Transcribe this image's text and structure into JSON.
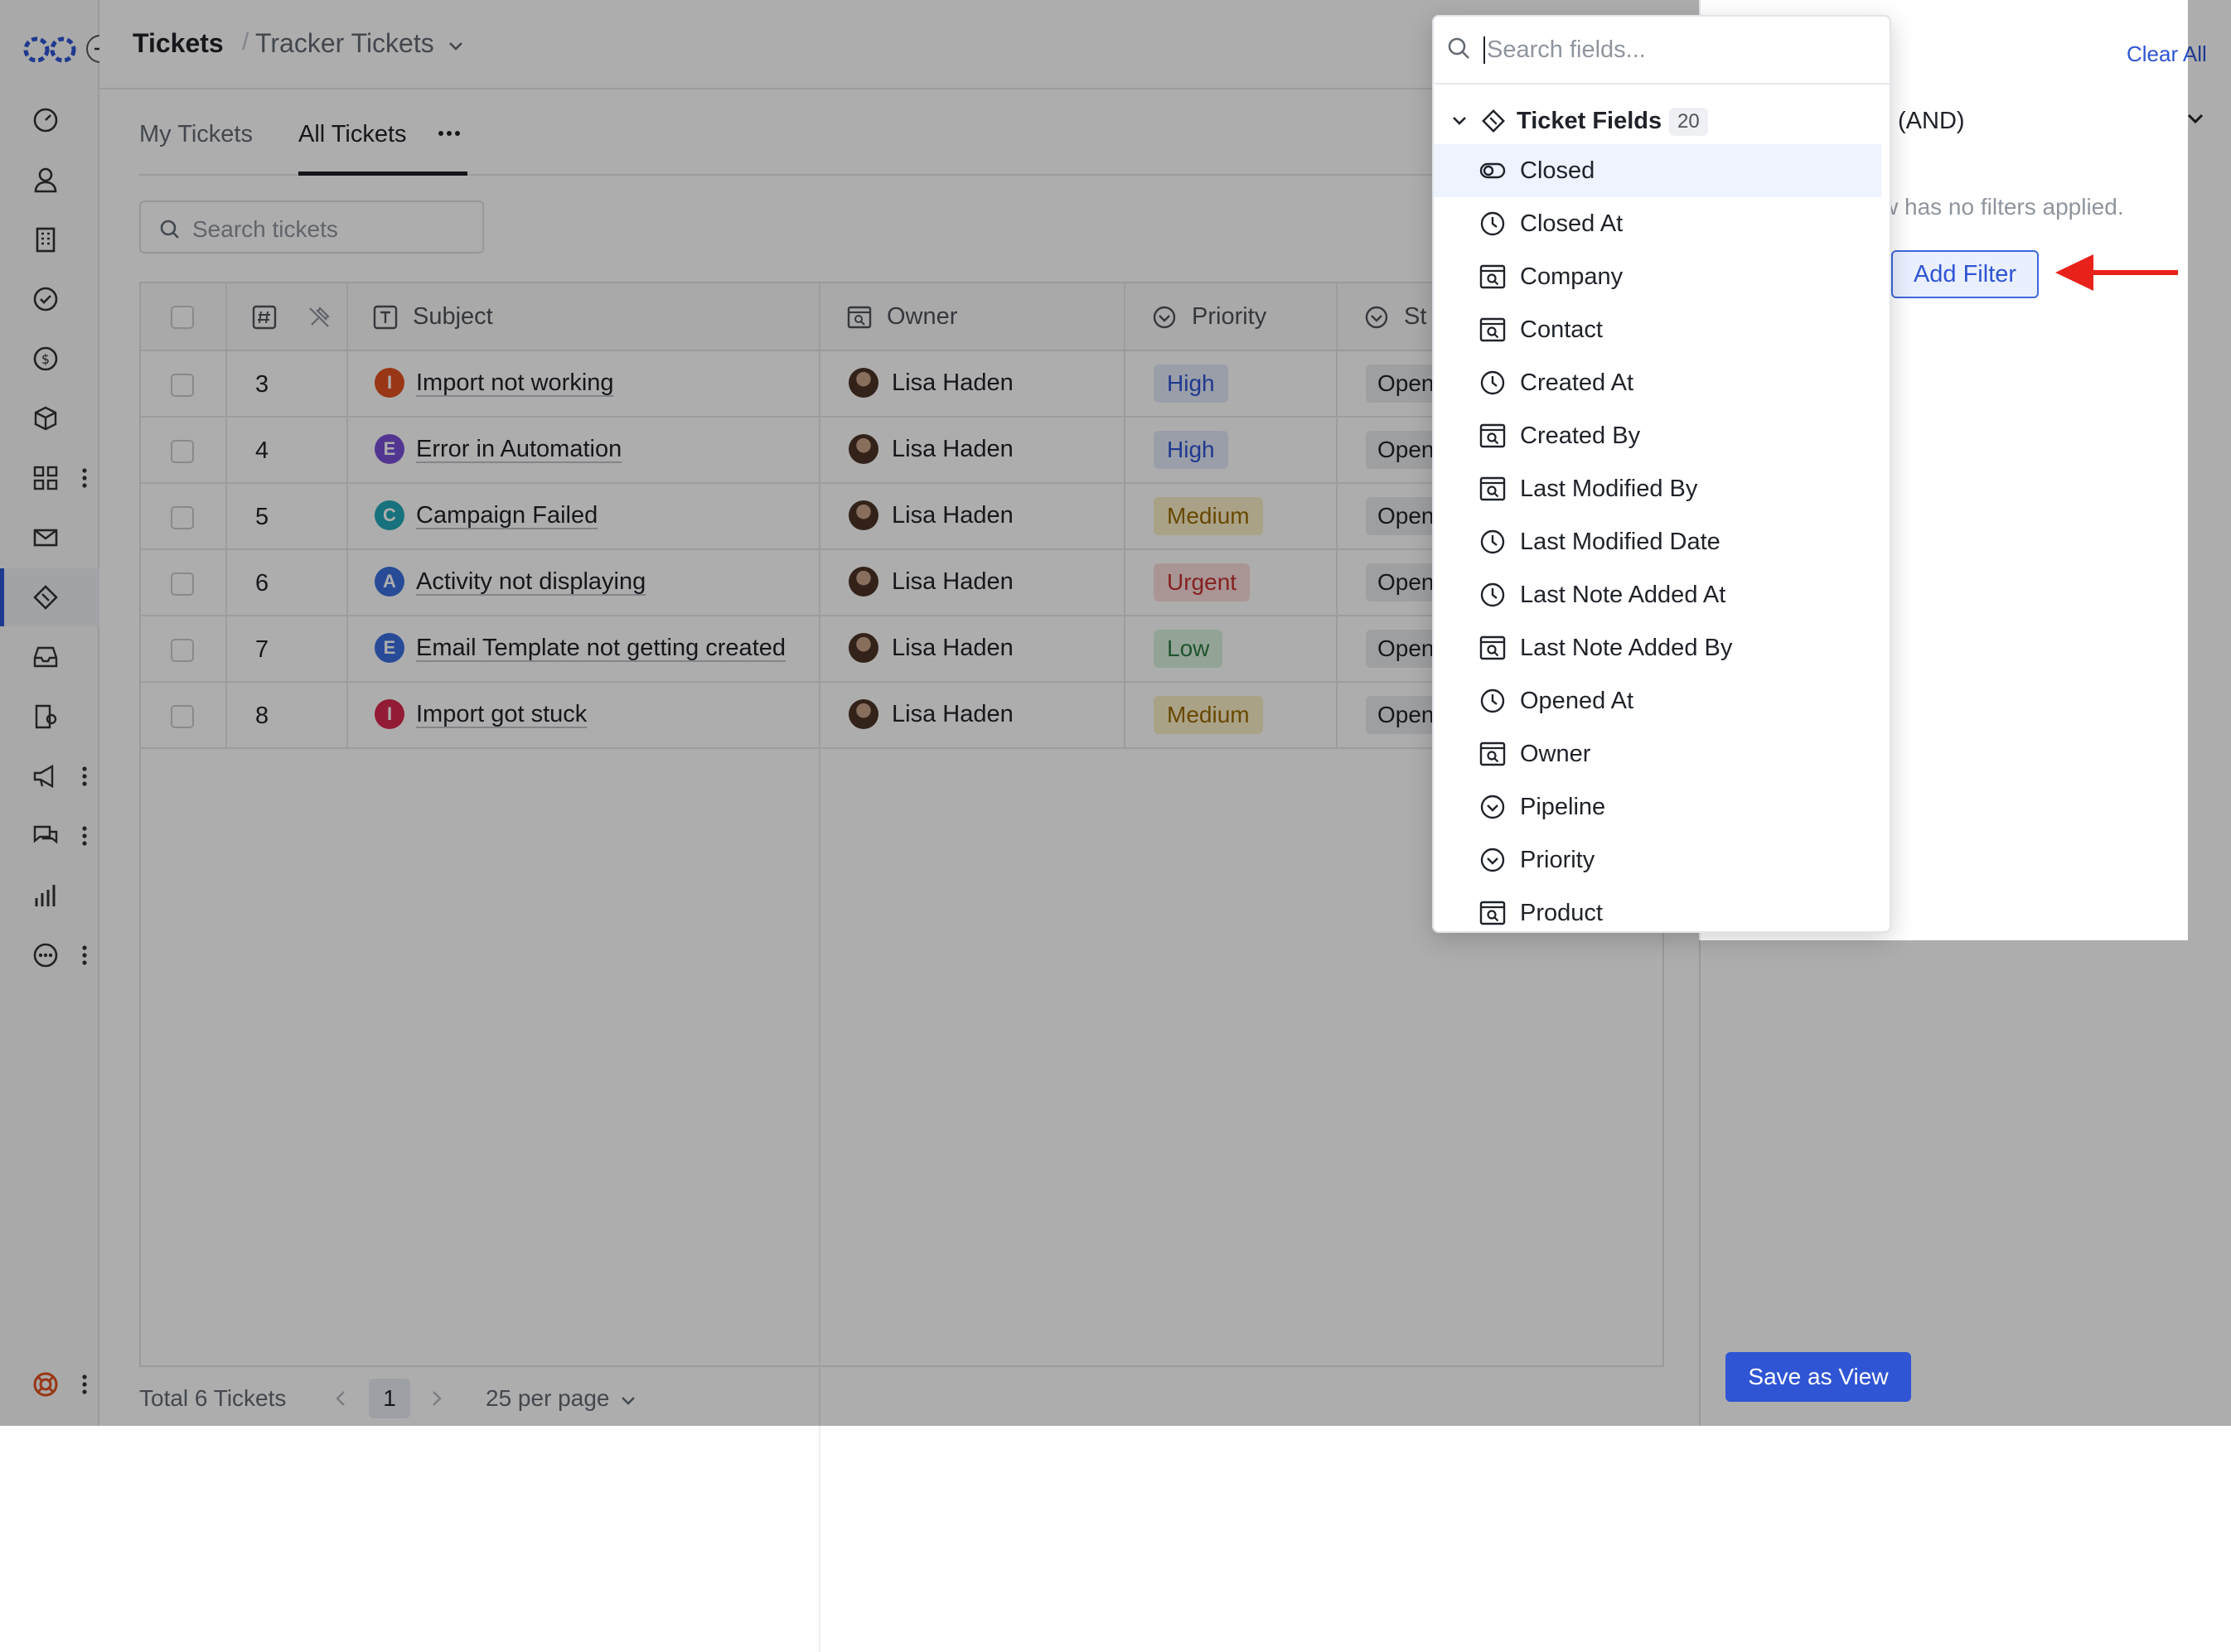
{
  "header": {
    "title": "Tickets",
    "separator": "/",
    "view_name": "Tracker Tickets"
  },
  "tabs": [
    {
      "label": "My Tickets"
    },
    {
      "label": "All Tickets"
    }
  ],
  "search": {
    "placeholder": "Search tickets"
  },
  "table": {
    "columns": {
      "id": "#",
      "subject": "Subject",
      "owner": "Owner",
      "priority": "Priority",
      "status": "St"
    },
    "rows": [
      {
        "id": "3",
        "subject": "Import not working",
        "badge": "I",
        "badge_color": "#e2501f",
        "owner": "Lisa Haden",
        "priority": "High",
        "status": "Open"
      },
      {
        "id": "4",
        "subject": "Error in Automation",
        "badge": "E",
        "badge_color": "#7a4fd6",
        "owner": "Lisa Haden",
        "priority": "High",
        "status": "Open"
      },
      {
        "id": "5",
        "subject": "Campaign Failed",
        "badge": "C",
        "badge_color": "#23a8b8",
        "owner": "Lisa Haden",
        "priority": "Medium",
        "status": "Open"
      },
      {
        "id": "6",
        "subject": "Activity not displaying",
        "badge": "A",
        "badge_color": "#3b6fe0",
        "owner": "Lisa Haden",
        "priority": "Urgent",
        "status": "Open"
      },
      {
        "id": "7",
        "subject": "Email Template not getting created",
        "badge": "E",
        "badge_color": "#3b6fe0",
        "owner": "Lisa Haden",
        "priority": "Low",
        "status": "Open"
      },
      {
        "id": "8",
        "subject": "Import got stuck",
        "badge": "I",
        "badge_color": "#d8284f",
        "owner": "Lisa Haden",
        "priority": "Medium",
        "status": "Open"
      }
    ]
  },
  "priority_colors": {
    "High": {
      "bg": "#e3e9f8",
      "fg": "#2f55d4"
    },
    "Medium": {
      "bg": "#fbefc8",
      "fg": "#9a6a00"
    },
    "Urgent": {
      "bg": "#fbdcdc",
      "fg": "#c53030"
    },
    "Low": {
      "bg": "#d9f2df",
      "fg": "#2f7d43"
    }
  },
  "footer": {
    "total": "Total 6 Tickets",
    "page": "1",
    "per_page": "25 per page"
  },
  "filter_panel": {
    "clear_all": "Clear All",
    "logic": "(AND)",
    "empty_text": "w has no filters applied.",
    "add_filter": "Add Filter",
    "save_view": "Save as View"
  },
  "field_picker": {
    "placeholder": "Search fields...",
    "group_label": "Ticket Fields",
    "group_count": "20",
    "items": [
      {
        "label": "Closed",
        "icon": "toggle-icon"
      },
      {
        "label": "Closed At",
        "icon": "clock-icon"
      },
      {
        "label": "Company",
        "icon": "lookup-icon"
      },
      {
        "label": "Contact",
        "icon": "lookup-icon"
      },
      {
        "label": "Created At",
        "icon": "clock-icon"
      },
      {
        "label": "Created By",
        "icon": "lookup-icon"
      },
      {
        "label": "Last Modified By",
        "icon": "lookup-icon"
      },
      {
        "label": "Last Modified Date",
        "icon": "clock-icon"
      },
      {
        "label": "Last Note Added At",
        "icon": "clock-icon"
      },
      {
        "label": "Last Note Added By",
        "icon": "lookup-icon"
      },
      {
        "label": "Opened At",
        "icon": "clock-icon"
      },
      {
        "label": "Owner",
        "icon": "lookup-icon"
      },
      {
        "label": "Pipeline",
        "icon": "select-icon"
      },
      {
        "label": "Priority",
        "icon": "select-icon"
      },
      {
        "label": "Product",
        "icon": "lookup-icon"
      }
    ]
  },
  "accent_color": "#2f55d4"
}
